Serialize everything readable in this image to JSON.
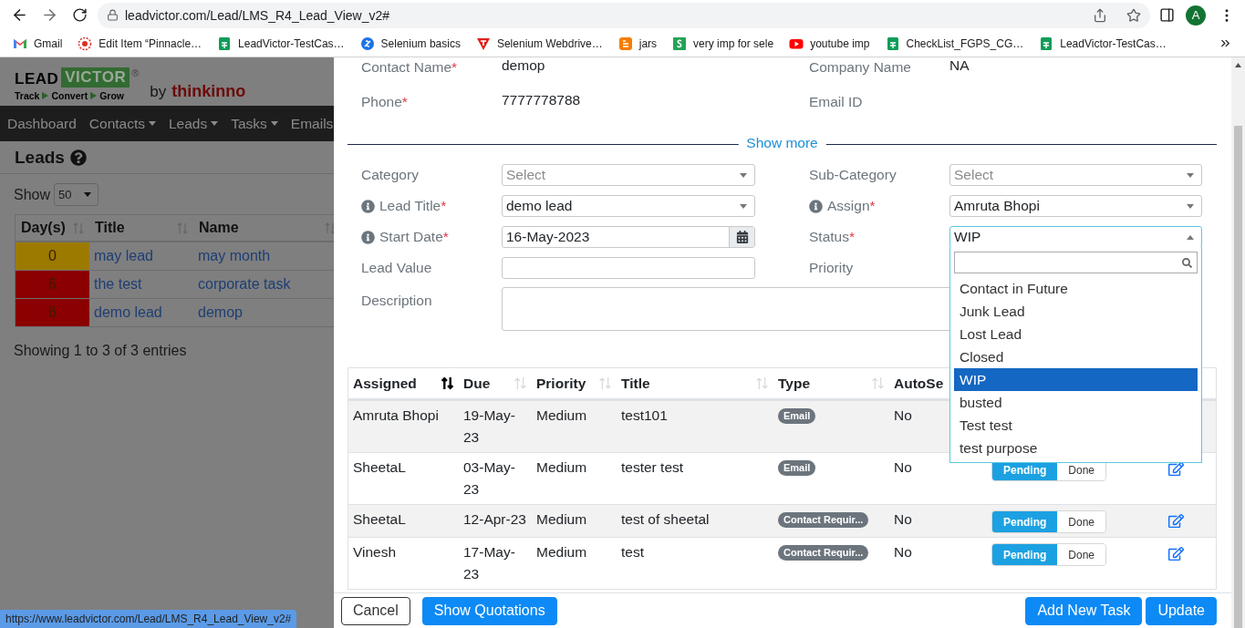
{
  "browser": {
    "url": "leadvictor.com/Lead/LMS_R4_Lead_View_v2#",
    "profile_initial": "A",
    "bookmarks": [
      {
        "kind": "gmail",
        "label": "Gmail"
      },
      {
        "kind": "target",
        "label": "Edit Item “Pinnacle…"
      },
      {
        "kind": "sheets",
        "label": "LeadVictor-TestCas…"
      },
      {
        "kind": "selenium",
        "label": "Selenium basics"
      },
      {
        "kind": "triangle",
        "label": "Selenium Webdrive…"
      },
      {
        "kind": "blogger",
        "label": "jars"
      },
      {
        "kind": "square",
        "label": "very imp for sele"
      },
      {
        "kind": "youtube",
        "label": "youtube imp"
      },
      {
        "kind": "sheets",
        "label": "CheckList_FGPS_CG…"
      },
      {
        "kind": "sheets",
        "label": "LeadVictor-TestCas…"
      }
    ],
    "status_url": "https://www.leadvictor.com/Lead/LMS_R4_Lead_View_v2#"
  },
  "app": {
    "logo": {
      "lead": "LEAD",
      "victor": "VICTOR",
      "mark": "®",
      "tagline": [
        "Track",
        "Convert",
        "Grow"
      ],
      "by": "by",
      "brand": "thinkinno"
    },
    "nav": [
      {
        "label": "Dashboard",
        "dropdown": false
      },
      {
        "label": "Contacts",
        "dropdown": true
      },
      {
        "label": "Leads",
        "dropdown": true
      },
      {
        "label": "Tasks",
        "dropdown": true
      },
      {
        "label": "Emails",
        "dropdown": false
      }
    ],
    "title": "Leads",
    "show_label": "Show",
    "page_size": "50",
    "table": {
      "columns": [
        "Day(s)",
        "Title",
        "Name"
      ],
      "rows": [
        {
          "days": "0",
          "color": "#9c7a00",
          "title": "may lead",
          "name": "may month"
        },
        {
          "days": "6",
          "color": "#8b0000",
          "title": "the test",
          "name": "corporate task"
        },
        {
          "days": "6",
          "color": "#8b0000",
          "title": "demo lead",
          "name": "demop"
        }
      ]
    },
    "info": "Showing 1 to 3 of 3 entries"
  },
  "modal": {
    "required_mark": "*",
    "contact_fields": [
      {
        "label": "Contact Name",
        "required": true,
        "value": "demop"
      },
      {
        "label": "Company Name",
        "required": false,
        "value": "NA"
      },
      {
        "label": "Phone",
        "required": true,
        "value": "7777778788"
      },
      {
        "label": "Email ID",
        "required": false
      }
    ],
    "show_more": "Show more",
    "form_fields": [
      {
        "kind": "select",
        "label": "Category",
        "info": false,
        "required": false,
        "placeholder": "Select"
      },
      {
        "kind": "select",
        "label": "Sub-Category",
        "info": false,
        "required": false,
        "placeholder": "Select"
      },
      {
        "kind": "select",
        "label": "Lead Title",
        "info": true,
        "required": true,
        "value": "demo lead"
      },
      {
        "kind": "select",
        "label": "Assign",
        "info": true,
        "required": true,
        "value": "Amruta Bhopi"
      },
      {
        "kind": "date",
        "label": "Start Date",
        "info": true,
        "required": true,
        "value": "16-May-2023"
      },
      {
        "kind": "select",
        "label": "Status",
        "info": false,
        "required": true,
        "value": "WIP",
        "open": true,
        "options": [
          {
            "label": "Contact in Future",
            "selected": false
          },
          {
            "label": "Junk Lead",
            "selected": false
          },
          {
            "label": "Lost Lead",
            "selected": false
          },
          {
            "label": "Closed",
            "selected": false
          },
          {
            "label": "WIP",
            "selected": true
          },
          {
            "label": "busted",
            "selected": false
          },
          {
            "label": "Test test",
            "selected": false
          },
          {
            "label": "test purpose",
            "selected": false
          }
        ]
      },
      {
        "kind": "text",
        "label": "Lead Value",
        "info": false,
        "required": false
      },
      {
        "label": "Priority",
        "info": false,
        "required": false
      },
      {
        "kind": "textarea",
        "label": "Description",
        "info": false,
        "required": false
      }
    ],
    "tasks": {
      "columns": [
        {
          "label": "Assigned",
          "sorted": true
        },
        {
          "label": "Due",
          "sorted": false
        },
        {
          "label": "Priority",
          "sorted": false
        },
        {
          "label": "Title",
          "sorted": false
        },
        {
          "label": "Type",
          "sorted": false
        },
        {
          "label": "AutoSe"
        }
      ],
      "rows": [
        {
          "assigned": "Amruta Bhopi",
          "due": "19-May-23",
          "priority": "Medium",
          "title": "test101",
          "type": "Email",
          "auto_send": "No"
        },
        {
          "assigned": "SheetaL",
          "due": "03-May-23",
          "priority": "Medium",
          "title": "tester test",
          "type": "Email",
          "auto_send": "No",
          "status": [
            {
              "label": "Pending",
              "selected": true
            },
            {
              "label": "Done",
              "selected": false
            }
          ]
        },
        {
          "assigned": "SheetaL",
          "due": "12-Apr-23",
          "priority": "Medium",
          "title": "test of sheetal",
          "type": "Contact Requir...",
          "auto_send": "No",
          "status": [
            {
              "label": "Pending",
              "selected": true
            },
            {
              "label": "Done",
              "selected": false
            }
          ]
        },
        {
          "assigned": "Vinesh",
          "due": "17-May-23",
          "priority": "Medium",
          "title": "test",
          "type": "Contact Requir...",
          "auto_send": "No",
          "status": [
            {
              "label": "Pending",
              "selected": true
            },
            {
              "label": "Done",
              "selected": false
            }
          ]
        }
      ]
    },
    "buttons_left": [
      {
        "label": "Cancel",
        "kind": "outline"
      },
      {
        "label": "Show Quotations",
        "kind": "primary"
      }
    ],
    "buttons_right": [
      {
        "label": "Add New Task",
        "kind": "primary"
      },
      {
        "label": "Update",
        "kind": "primary"
      }
    ]
  }
}
